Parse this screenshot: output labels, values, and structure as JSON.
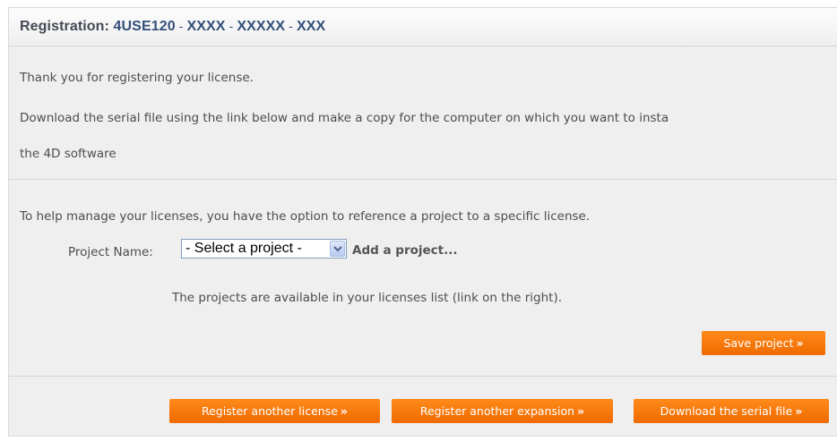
{
  "header": {
    "label": "Registration:",
    "product_code": "4USE120",
    "sep1": " - ",
    "part1": "XXXX",
    "sep2": " - ",
    "part2": "XXXXX",
    "sep3": " - ",
    "part3": "XXX"
  },
  "message": {
    "line1": "Thank you for registering your license.",
    "line2": "Download the serial file using the link below and make a copy for the computer on which you want to insta",
    "line3": "the 4D software"
  },
  "project_section": {
    "intro": "To help manage your licenses, you have the option to reference a project to a specific license.",
    "field_label": "Project Name:",
    "select_value": "- Select a project -",
    "add_project": "Add a project...",
    "note": "The projects are available in your licenses list (link on the right).",
    "save_button": "Save project",
    "arrow_glyph": "»"
  },
  "footer": {
    "register_license_button": "Register another license",
    "register_expansion_button": "Register another expansion",
    "download_button": "Download the serial file",
    "arrow_glyph": "»"
  },
  "colors": {
    "accent_orange": "#f07800",
    "title_blue": "#334f7a",
    "panel_bg": "#efefef"
  }
}
